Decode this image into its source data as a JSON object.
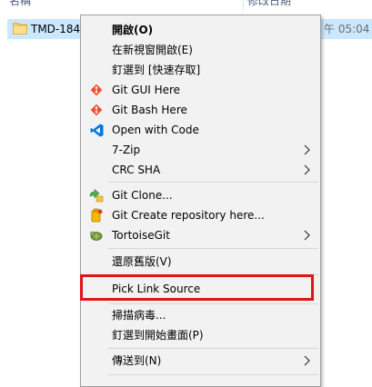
{
  "explorer": {
    "columns": {
      "name": "名稱",
      "date_modified": "修改日期"
    },
    "selected_item": {
      "name": "TMD-184",
      "date": "午 05:04",
      "icon": "folder-icon"
    }
  },
  "context_menu": {
    "items": [
      {
        "label": "開啟(O)",
        "bold": true,
        "icon": ""
      },
      {
        "label": "在新視窗開啟(E)",
        "icon": ""
      },
      {
        "label": "釘選到 [快速存取]",
        "icon": ""
      },
      {
        "label": "Git GUI Here",
        "icon": "git-icon"
      },
      {
        "label": "Git Bash Here",
        "icon": "git-icon"
      },
      {
        "label": "Open with Code",
        "icon": "vscode-icon"
      },
      {
        "label": "7-Zip",
        "icon": "",
        "submenu": true
      },
      {
        "label": "CRC SHA",
        "icon": "",
        "submenu": true
      },
      {
        "label": "Git Clone...",
        "icon": "tortoisegit-clone-icon"
      },
      {
        "label": "Git Create repository here...",
        "icon": "tortoisegit-create-repo-icon"
      },
      {
        "label": "TortoiseGit",
        "icon": "tortoisegit-icon",
        "submenu": true
      },
      {
        "label": "還原舊版(V)",
        "icon": ""
      },
      {
        "label": "Pick Link Source",
        "icon": ""
      },
      {
        "label": "掃描病毒...",
        "icon": ""
      },
      {
        "label": "釘選到開始畫面(P)",
        "icon": ""
      },
      {
        "label": "傳送到(N)",
        "icon": "",
        "submenu": true
      }
    ]
  },
  "colors": {
    "menu_background": "#f2f2f2",
    "selection_background": "#cce8ff",
    "highlight_border": "#e0141b",
    "vscode_blue": "#0078d7",
    "git_orange": "#f05133"
  }
}
